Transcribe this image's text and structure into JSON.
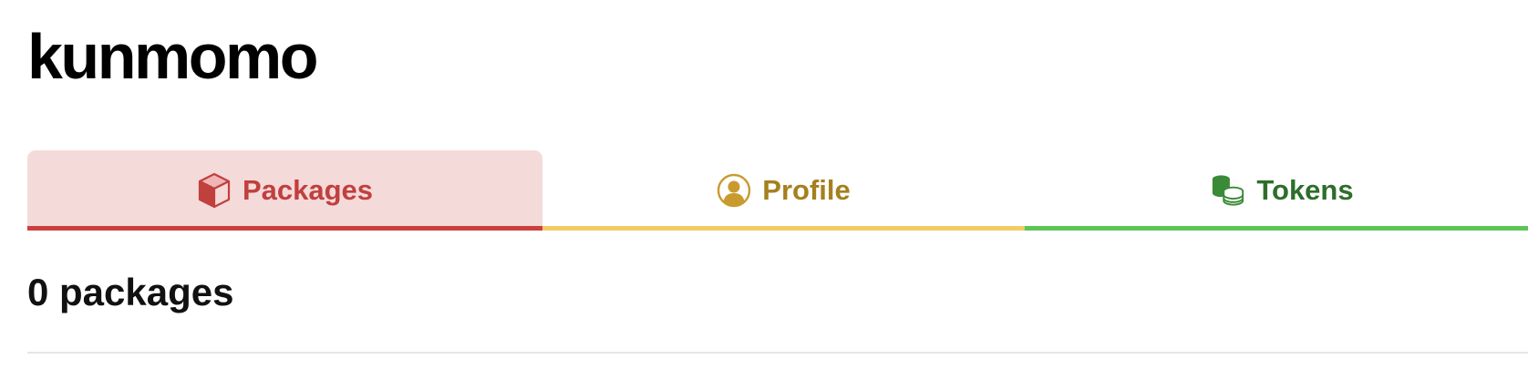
{
  "profile": {
    "username": "kunmomo"
  },
  "tabs": [
    {
      "label": "Packages",
      "icon": "package-cube-icon",
      "active": true,
      "color": "#c9403f"
    },
    {
      "label": "Profile",
      "icon": "user-avatar-icon",
      "active": false,
      "color": "#f2cc63"
    },
    {
      "label": "Tokens",
      "icon": "coins-stack-icon",
      "active": false,
      "color": "#5cc558"
    }
  ],
  "colors": {
    "packages_accent": "#c9403f",
    "packages_bg": "#f5dada",
    "profile_accent": "#a67f1e",
    "tokens_accent": "#2d6e2b",
    "organizations_accent": "#8b6cf0"
  },
  "packages": {
    "count_label": "0 packages"
  }
}
